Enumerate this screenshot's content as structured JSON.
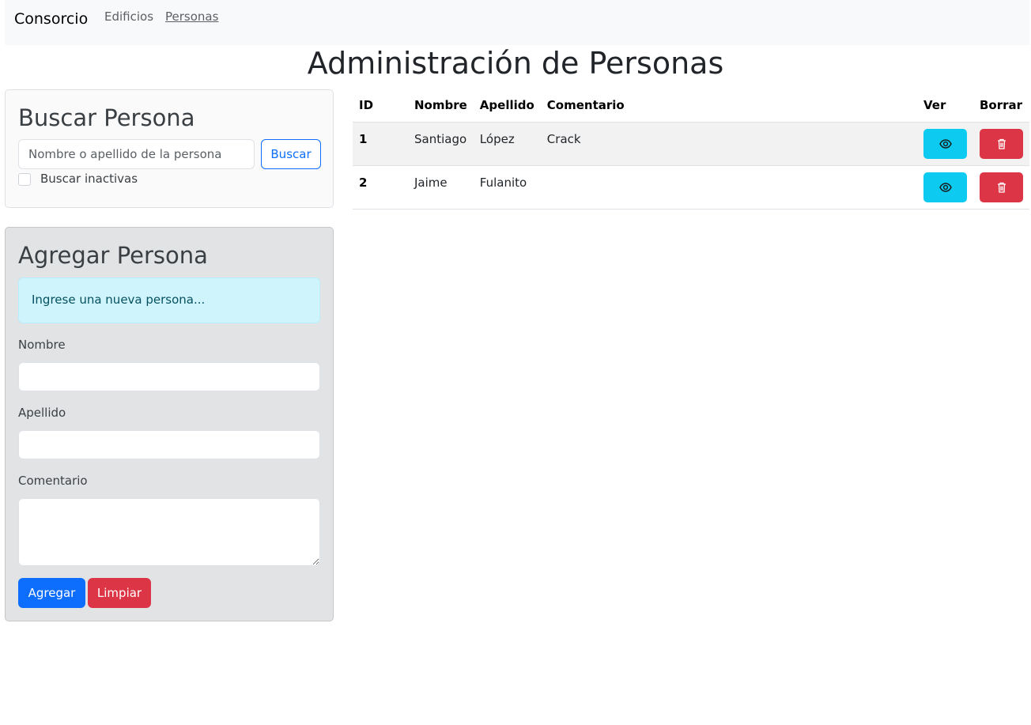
{
  "navbar": {
    "brand": "Consorcio",
    "links": [
      {
        "label": "Edificios",
        "active": false
      },
      {
        "label": "Personas",
        "active": true
      }
    ]
  },
  "page_title": "Administración de Personas",
  "search": {
    "title": "Buscar Persona",
    "placeholder": "Nombre o apellido de la persona",
    "value": "",
    "button": "Buscar",
    "checkbox_label": "Buscar inactivas",
    "checked": false
  },
  "add": {
    "title": "Agregar Persona",
    "alert": "Ingrese una nueva persona...",
    "fields": [
      {
        "label": "Nombre",
        "value": ""
      },
      {
        "label": "Apellido",
        "value": ""
      },
      {
        "label": "Comentario",
        "value": ""
      }
    ],
    "submit": "Agregar",
    "clear": "Limpiar"
  },
  "table": {
    "columns": [
      "ID",
      "Nombre",
      "Apellido",
      "Comentario",
      "Ver",
      "Borrar"
    ],
    "rows": [
      {
        "id": "1",
        "nombre": "Santiago",
        "apellido": "López",
        "comentario": "Crack"
      },
      {
        "id": "2",
        "nombre": "Jaime",
        "apellido": "Fulanito",
        "comentario": ""
      }
    ],
    "view_icon": "eye-icon",
    "delete_icon": "trash-icon"
  },
  "colors": {
    "primary": "#0d6efd",
    "danger": "#dc3545",
    "info": "#0dcaf0",
    "alert_bg": "#cff4fc"
  }
}
